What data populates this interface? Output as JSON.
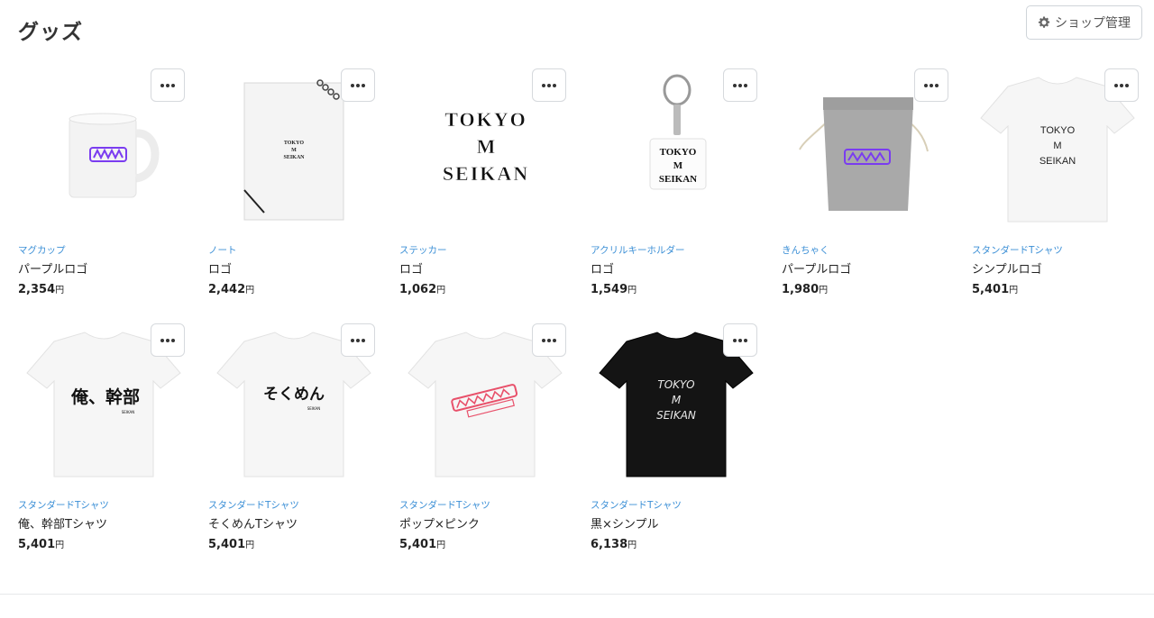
{
  "header": {
    "title": "グッズ",
    "shop_button_label": "ショップ管理",
    "shop_button_icon": "gear-icon"
  },
  "colors": {
    "category_link": "#3b8fd6",
    "button_border": "#cfd4d9"
  },
  "products": [
    {
      "category": "マグカップ",
      "name": "パープルロゴ",
      "price": "2,354",
      "currency": "円",
      "menu_icon": "more-icon"
    },
    {
      "category": "ノート",
      "name": "ロゴ",
      "price": "2,442",
      "currency": "円",
      "menu_icon": "more-icon"
    },
    {
      "category": "ステッカー",
      "name": "ロゴ",
      "price": "1,062",
      "currency": "円",
      "menu_icon": "more-icon"
    },
    {
      "category": "アクリルキーホルダー",
      "name": "ロゴ",
      "price": "1,549",
      "currency": "円",
      "menu_icon": "more-icon"
    },
    {
      "category": "きんちゃく",
      "name": "パープルロゴ",
      "price": "1,980",
      "currency": "円",
      "menu_icon": "more-icon"
    },
    {
      "category": "スタンダードTシャツ",
      "name": "シンプルロゴ",
      "price": "5,401",
      "currency": "円",
      "menu_icon": "more-icon"
    },
    {
      "category": "スタンダードTシャツ",
      "name": "俺、幹部Tシャツ",
      "price": "5,401",
      "currency": "円",
      "menu_icon": "more-icon"
    },
    {
      "category": "スタンダードTシャツ",
      "name": "そくめんTシャツ",
      "price": "5,401",
      "currency": "円",
      "menu_icon": "more-icon"
    },
    {
      "category": "スタンダードTシャツ",
      "name": "ポップ×ピンク",
      "price": "5,401",
      "currency": "円",
      "menu_icon": "more-icon"
    },
    {
      "category": "スタンダードTシャツ",
      "name": "黒×シンプル",
      "price": "6,138",
      "currency": "円",
      "menu_icon": "more-icon"
    }
  ],
  "product_images": {
    "notebook_print": [
      "TOKYO",
      "M",
      "SEIKAN"
    ],
    "sticker_print": [
      "TOKYO",
      "M",
      "SEIKAN"
    ],
    "keyholder_print": [
      "TOKYO",
      "M",
      "SEIKAN"
    ],
    "simple_tee_print": [
      "TOKYO",
      "M",
      "SEIKAN"
    ],
    "kanbu_tee_print": "俺、幹部",
    "kanbu_tee_small": "SEIKAN",
    "sokumen_tee_print": "そくめん",
    "sokumen_tee_small": "SEIKAN",
    "black_tee_print": [
      "TOKYO",
      "M",
      "SEIKAN"
    ],
    "pop_tee_color": "#e8506a",
    "purple_logo_color": "#7a3cf0"
  }
}
